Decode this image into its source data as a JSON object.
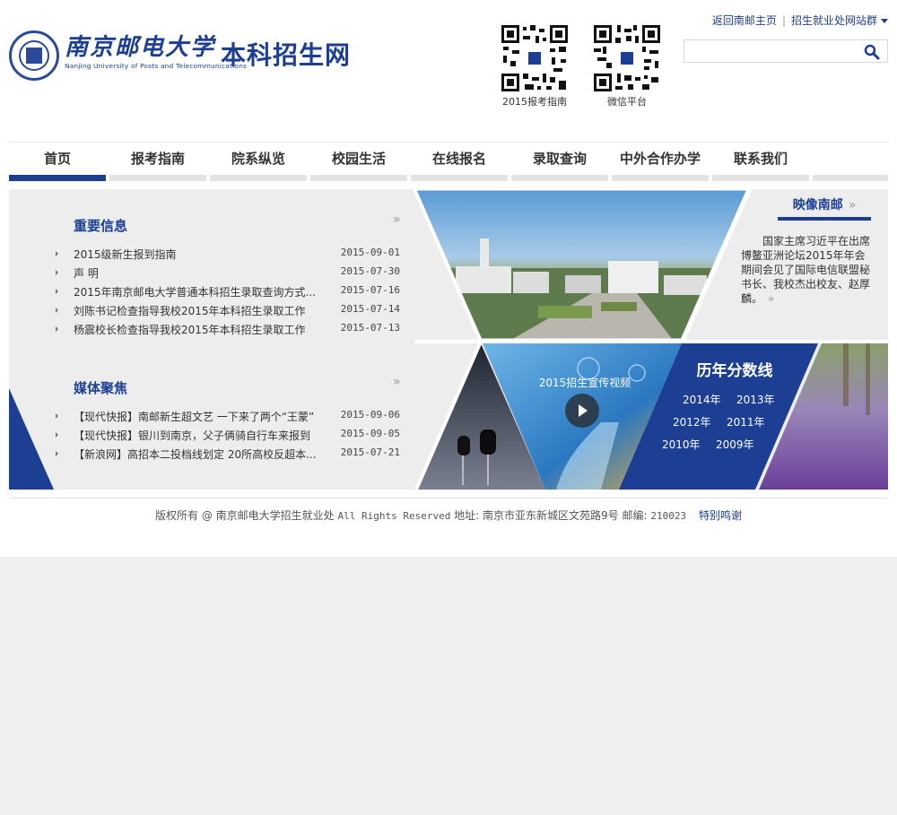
{
  "header": {
    "university_cn": "南京邮电大学",
    "university_en": "Nanjing University of Posts and Telecommunications",
    "site_name": "本科招生网",
    "qr_codes": [
      {
        "label": "2015报考指南",
        "icon": "qr-code-icon"
      },
      {
        "label": "微信平台",
        "icon": "qr-code-icon"
      }
    ],
    "links": {
      "home": "返回南邮主页",
      "group": "招生就业处网站群"
    },
    "search": {
      "placeholder": "",
      "icon": "search-icon"
    }
  },
  "nav": {
    "items": [
      "首页",
      "报考指南",
      "院系纵览",
      "校园生活",
      "在线报名",
      "录取查询",
      "中外合作办学",
      "联系我们"
    ],
    "active": 0
  },
  "news": {
    "title": "重要信息",
    "more": "»",
    "items": [
      {
        "text": "2015级新生报到指南",
        "date": "2015-09-01"
      },
      {
        "text": "声 明",
        "date": "2015-07-30"
      },
      {
        "text": "2015年南京邮电大学普通本科招生录取查询方式...",
        "date": "2015-07-16"
      },
      {
        "text": "刘陈书记检查指导我校2015年本科招生录取工作",
        "date": "2015-07-14"
      },
      {
        "text": "杨震校长检查指导我校2015年本科招生录取工作",
        "date": "2015-07-13"
      }
    ]
  },
  "media": {
    "title": "媒体聚焦",
    "more": "»",
    "items": [
      {
        "text": "【现代快报】南邮新生超文艺 一下来了两个“王蒙”",
        "date": "2015-09-06"
      },
      {
        "text": "【现代快报】银川到南京，父子俩骑自行车来报到",
        "date": "2015-09-05"
      },
      {
        "text": "【新浪网】高招本二投档线划定 20所高校反超本...",
        "date": "2015-07-21"
      }
    ]
  },
  "yingxiang": {
    "title": "映像南邮",
    "more": "»",
    "text": "国家主席习近平在出席博鳌亚洲论坛2015年年会期间会见了国际电信联盟秘书长、我校杰出校友、赵厚麟。"
  },
  "video": {
    "label": "2015招生宣传视频",
    "icon": "play-icon"
  },
  "scores": {
    "title": "历年分数线",
    "years": [
      "2014年",
      "2013年",
      "2012年",
      "2011年",
      "2010年",
      "2009年"
    ]
  },
  "footer": {
    "copyright": "版权所有 @ 南京邮电大学招生就业处",
    "rights": "All Rights Reserved",
    "address": "地址: 南京市亚东新城区文苑路9号",
    "postcode": "邮编:",
    "postcode_value": "210023",
    "thanks": "特别鸣谢"
  },
  "colors": {
    "brand": "#1c3f94",
    "panel": "#ededed"
  }
}
